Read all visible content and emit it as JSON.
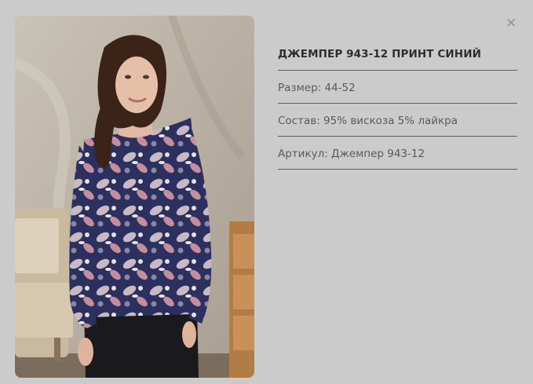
{
  "product": {
    "title": "ДЖЕМПЕР 943-12 ПРИНТ СИНИЙ",
    "size": "Размер: 44-52",
    "composition": "Состав: 95% вискоза 5% лайкра",
    "article": "Артикул: Джемпер 943-12"
  },
  "icons": {
    "close": "×"
  },
  "colors": {
    "overlay": "#cbcbcb",
    "title": "#2e2e2e",
    "text": "#5a5a5a",
    "divider": "#5e5e5e",
    "print_navy": "#2a2f5e",
    "print_pink": "#c48e9e"
  }
}
